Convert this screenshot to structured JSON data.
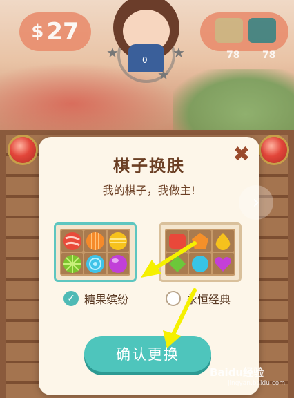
{
  "hud": {
    "coins": "27",
    "coins_icon": "dollar-icon",
    "resource1_count": "78",
    "resource2_count": "78",
    "avatar_level": "0"
  },
  "dialog": {
    "title": "棋子换肤",
    "subtitle": "我的棋子，我做主!",
    "close_icon": "close-icon",
    "skins": [
      {
        "label": "糖果缤纷",
        "selected": true
      },
      {
        "label": "永恒经典",
        "selected": false
      }
    ],
    "confirm_label": "确认更换"
  },
  "watermark": {
    "text": "Baidu经验",
    "sub": "jingyan.baidu.com"
  },
  "colors": {
    "accent": "#4ec5bc",
    "title": "#6b3f24",
    "close": "#9a4a2c",
    "arrow": "#f5f000"
  }
}
